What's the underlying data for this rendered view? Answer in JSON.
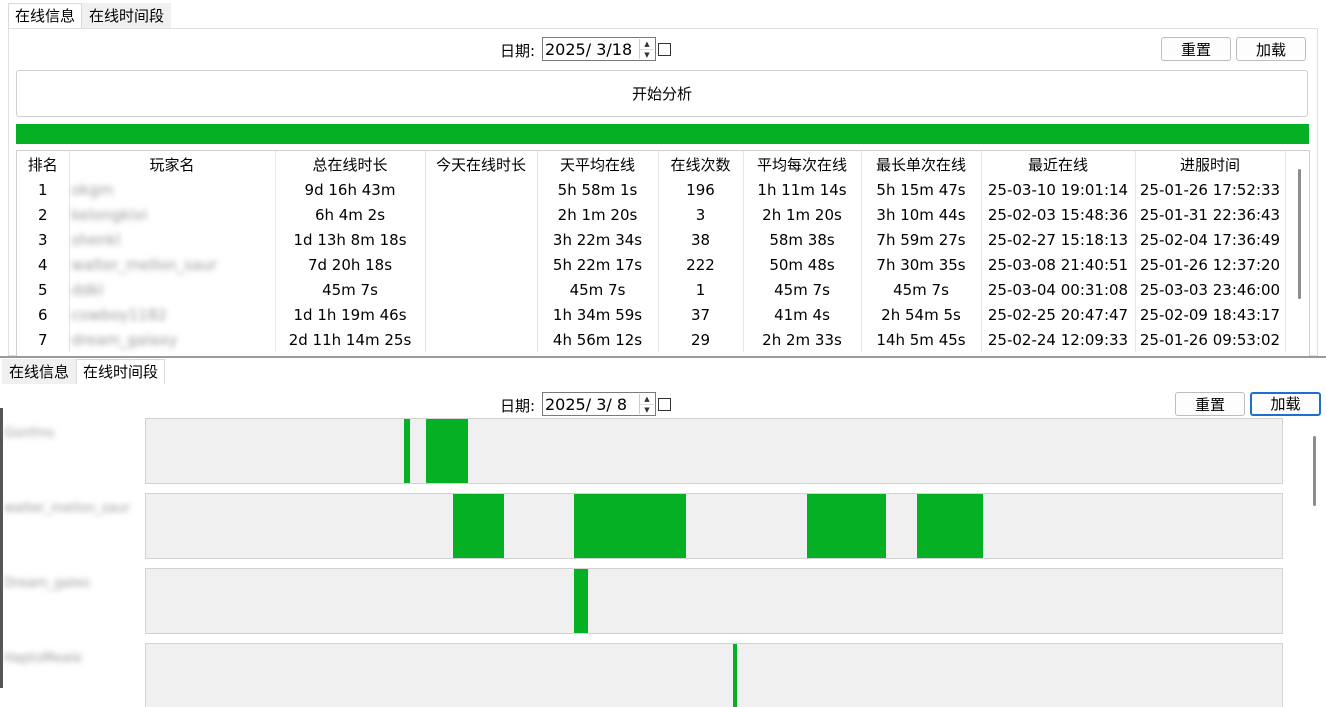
{
  "colors": {
    "accent_green": "#06b025",
    "lane_bg": "#f0f0f0",
    "focus_blue": "#1e6fd0"
  },
  "top": {
    "tabs": [
      {
        "label": "在线信息",
        "active": true
      },
      {
        "label": "在线时间段",
        "active": false
      }
    ],
    "date_label": "日期:",
    "date_value": "2025/  3/18",
    "reset_label": "重置",
    "load_label": "加载",
    "analyze_label": "开始分析",
    "progress_percent": 100,
    "columns": [
      "排名",
      "玩家名",
      "总在线时长",
      "今天在线时长",
      "天平均在线",
      "在线次数",
      "平均每次在线",
      "最长单次在线",
      "最近在线",
      "进服时间"
    ],
    "rows": [
      [
        "1",
        "okgm",
        "9d 16h 43m",
        "",
        "5h 58m 1s",
        "196",
        "1h 11m 14s",
        "5h 15m 47s",
        "25-03-10 19:01:14",
        "25-01-26 17:52:33"
      ],
      [
        "2",
        "kelongkivi",
        "6h 4m 2s",
        "",
        "2h 1m 20s",
        "3",
        "2h 1m 20s",
        "3h 10m 44s",
        "25-02-03 15:48:36",
        "25-01-31 22:36:43"
      ],
      [
        "3",
        "shenkl",
        "1d 13h 8m 18s",
        "",
        "3h 22m 34s",
        "38",
        "58m 38s",
        "7h 59m 27s",
        "25-02-27 15:18:13",
        "25-02-04 17:36:49"
      ],
      [
        "4",
        "walter_mellon_saur",
        "7d 20h 18s",
        "",
        "5h 22m 17s",
        "222",
        "50m 48s",
        "7h 30m 35s",
        "25-03-08 21:40:51",
        "25-01-26 12:37:20"
      ],
      [
        "5",
        "ddkl",
        "45m 7s",
        "",
        "45m 7s",
        "1",
        "45m 7s",
        "45m 7s",
        "25-03-04 00:31:08",
        "25-03-03 23:46:00"
      ],
      [
        "6",
        "cowboy1182",
        "1d 1h 19m 46s",
        "",
        "1h 34m 59s",
        "37",
        "41m 4s",
        "2h 54m 5s",
        "25-02-25 20:47:47",
        "25-02-09 18:43:17"
      ],
      [
        "7",
        "dream_galaxy",
        "2d 11h 14m 25s",
        "",
        "4h 56m 12s",
        "29",
        "2h 2m 33s",
        "14h 5m 45s",
        "25-02-24 12:09:33",
        "25-01-26 09:53:02"
      ]
    ]
  },
  "bottom": {
    "tabs": [
      {
        "label": "在线信息",
        "active": false
      },
      {
        "label": "在线时间段",
        "active": true
      }
    ],
    "date_label": "日期:",
    "date_value": "2025/  3/  8",
    "reset_label": "重置",
    "load_label": "加载",
    "players": [
      {
        "name": "Gonfms",
        "segments": [
          {
            "start": 0.2267,
            "end": 0.232
          },
          {
            "start": 0.2469,
            "end": 0.2838
          }
        ]
      },
      {
        "name": "walter_mellon_saur",
        "segments": [
          {
            "start": 0.2706,
            "end": 0.3155
          },
          {
            "start": 0.377,
            "end": 0.4754
          },
          {
            "start": 0.5817,
            "end": 0.6512
          },
          {
            "start": 0.6784,
            "end": 0.7364
          }
        ]
      },
      {
        "name": "Dream_galeo",
        "segments": [
          {
            "start": 0.377,
            "end": 0.3893
          }
        ]
      },
      {
        "name": "HaptoMeale",
        "segments": [
          {
            "start": 0.5167,
            "end": 0.5202
          }
        ]
      }
    ]
  }
}
